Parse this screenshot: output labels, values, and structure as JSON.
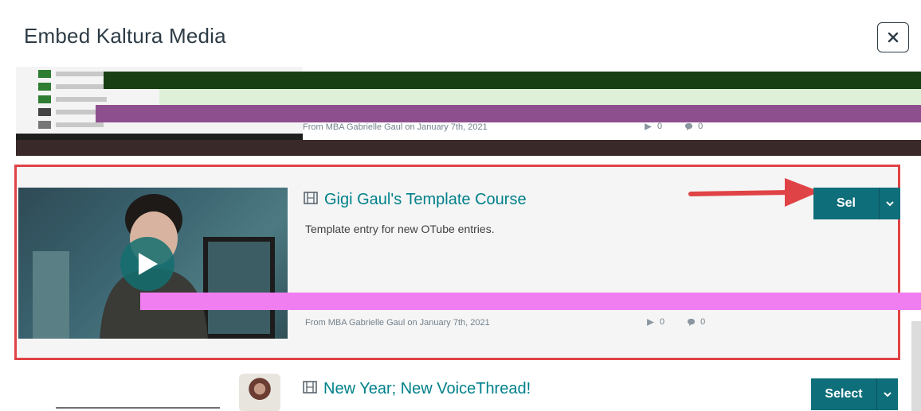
{
  "modal": {
    "title": "Embed Kaltura Media",
    "close_label": "×"
  },
  "entries": [
    {
      "meta": "From MBA Gabrielle Gaul on January 7th, 2021",
      "plays": "0",
      "comments": "0"
    },
    {
      "title": "Gigi Gaul's Template Course",
      "description": "Template entry for new OTube entries.",
      "meta": "From MBA Gabrielle Gaul on January 7th, 2021",
      "plays": "0",
      "comments": "0",
      "select_label": "Sel",
      "highlighted": true
    },
    {
      "title": "New Year; New VoiceThread!",
      "select_label": "Select"
    }
  ],
  "colors": {
    "accent": "#0e6e7a",
    "title_link": "#00808a",
    "highlight_border": "#e04345",
    "annotation_arrow": "#e04345"
  },
  "icons": {
    "close": "close-icon",
    "film": "film-icon",
    "play": "play-icon",
    "views": "views-icon",
    "comments": "comment-icon",
    "caret": "chevron-down-icon"
  }
}
